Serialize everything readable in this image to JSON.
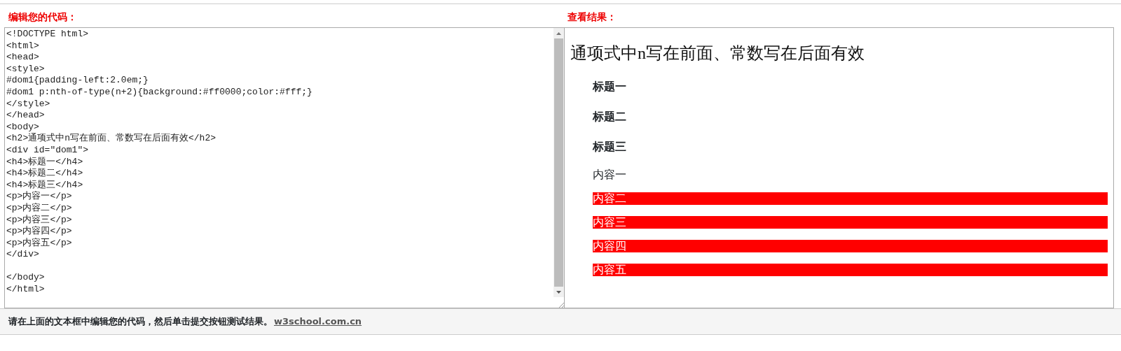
{
  "editor": {
    "title": "编辑您的代码：",
    "code": "<!DOCTYPE html>\n<html>\n<head>\n<style>\n#dom1{padding-left:2.0em;}\n#dom1 p:nth-of-type(n+2){background:#ff0000;color:#fff;}\n</style>\n</head>\n<body>\n<h2>通项式中n写在前面、常数写在后面有效</h2>\n<div id=\"dom1\">\n<h4>标题一</h4>\n<h4>标题二</h4>\n<h4>标题三</h4>\n<p>内容一</p>\n<p>内容二</p>\n<p>内容三</p>\n<p>内容四</p>\n<p>内容五</p>\n</div>\n\n</body>\n</html>"
  },
  "result": {
    "title": "查看结果：",
    "heading": "通项式中n写在前面、常数写在后面有效",
    "blocks": [
      {
        "kind": "heading",
        "text": "标题一",
        "highlighted": false
      },
      {
        "kind": "heading",
        "text": "标题二",
        "highlighted": false
      },
      {
        "kind": "heading",
        "text": "标题三",
        "highlighted": false
      },
      {
        "kind": "paragraph",
        "text": "内容一",
        "highlighted": false
      },
      {
        "kind": "paragraph",
        "text": "内容二",
        "highlighted": true
      },
      {
        "kind": "paragraph",
        "text": "内容三",
        "highlighted": true
      },
      {
        "kind": "paragraph",
        "text": "内容四",
        "highlighted": true
      },
      {
        "kind": "paragraph",
        "text": "内容五",
        "highlighted": true
      }
    ]
  },
  "footer": {
    "note": "请在上面的文本框中编辑您的代码，然后单击提交按钮测试结果。",
    "link": "w3school.com.cn"
  }
}
